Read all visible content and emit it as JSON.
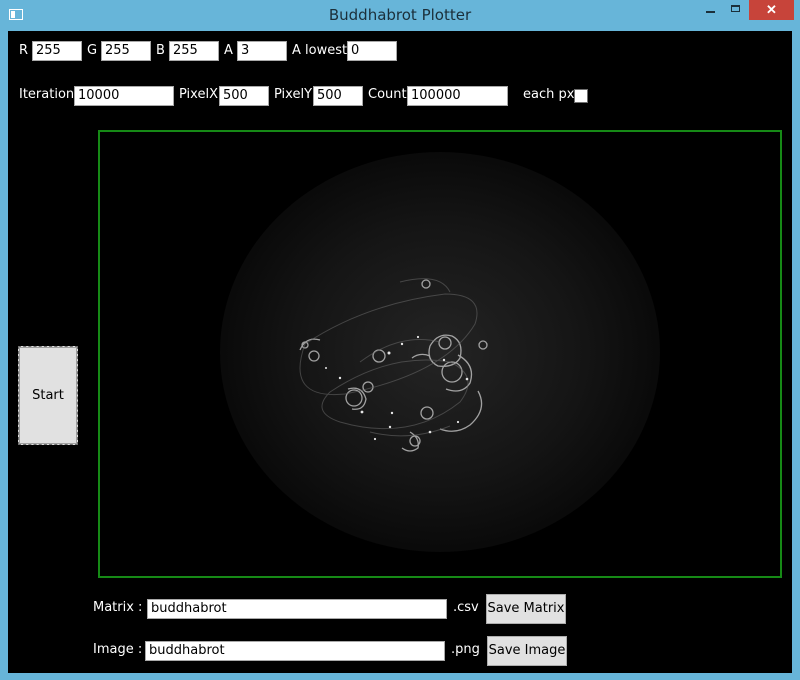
{
  "window": {
    "title": "Buddhabrot Plotter",
    "close_glyph": "✕"
  },
  "color": {
    "r_label": "R",
    "r_value": "255",
    "g_label": "G",
    "g_value": "255",
    "b_label": "B",
    "b_value": "255",
    "a_label": "A",
    "a_value": "3",
    "a_lowest_label": "A lowest",
    "a_lowest_value": "0"
  },
  "params": {
    "iteration_label": "Iteration",
    "iteration_value": "10000",
    "pixelx_label": "PixelX",
    "pixelx_value": "500",
    "pixely_label": "PixelY",
    "pixely_value": "500",
    "count_label": "Count",
    "count_value": "100000",
    "each_px_label": "each px",
    "each_px_checked": false
  },
  "start_label": "Start",
  "matrix": {
    "label": "Matrix :",
    "value": "buddhabrot",
    "ext": ".csv",
    "button": "Save Matrix"
  },
  "image": {
    "label": "Image :",
    "value": "buddhabrot",
    "ext": ".png",
    "button": "Save Image"
  },
  "icons": {
    "app": "app-window-icon",
    "minimize": "minimize-icon",
    "maximize": "maximize-icon",
    "close": "close-icon"
  },
  "colors": {
    "titlebar": "#67b5d9",
    "close": "#c7443a",
    "canvas_border": "#168a16",
    "background": "#000000"
  }
}
